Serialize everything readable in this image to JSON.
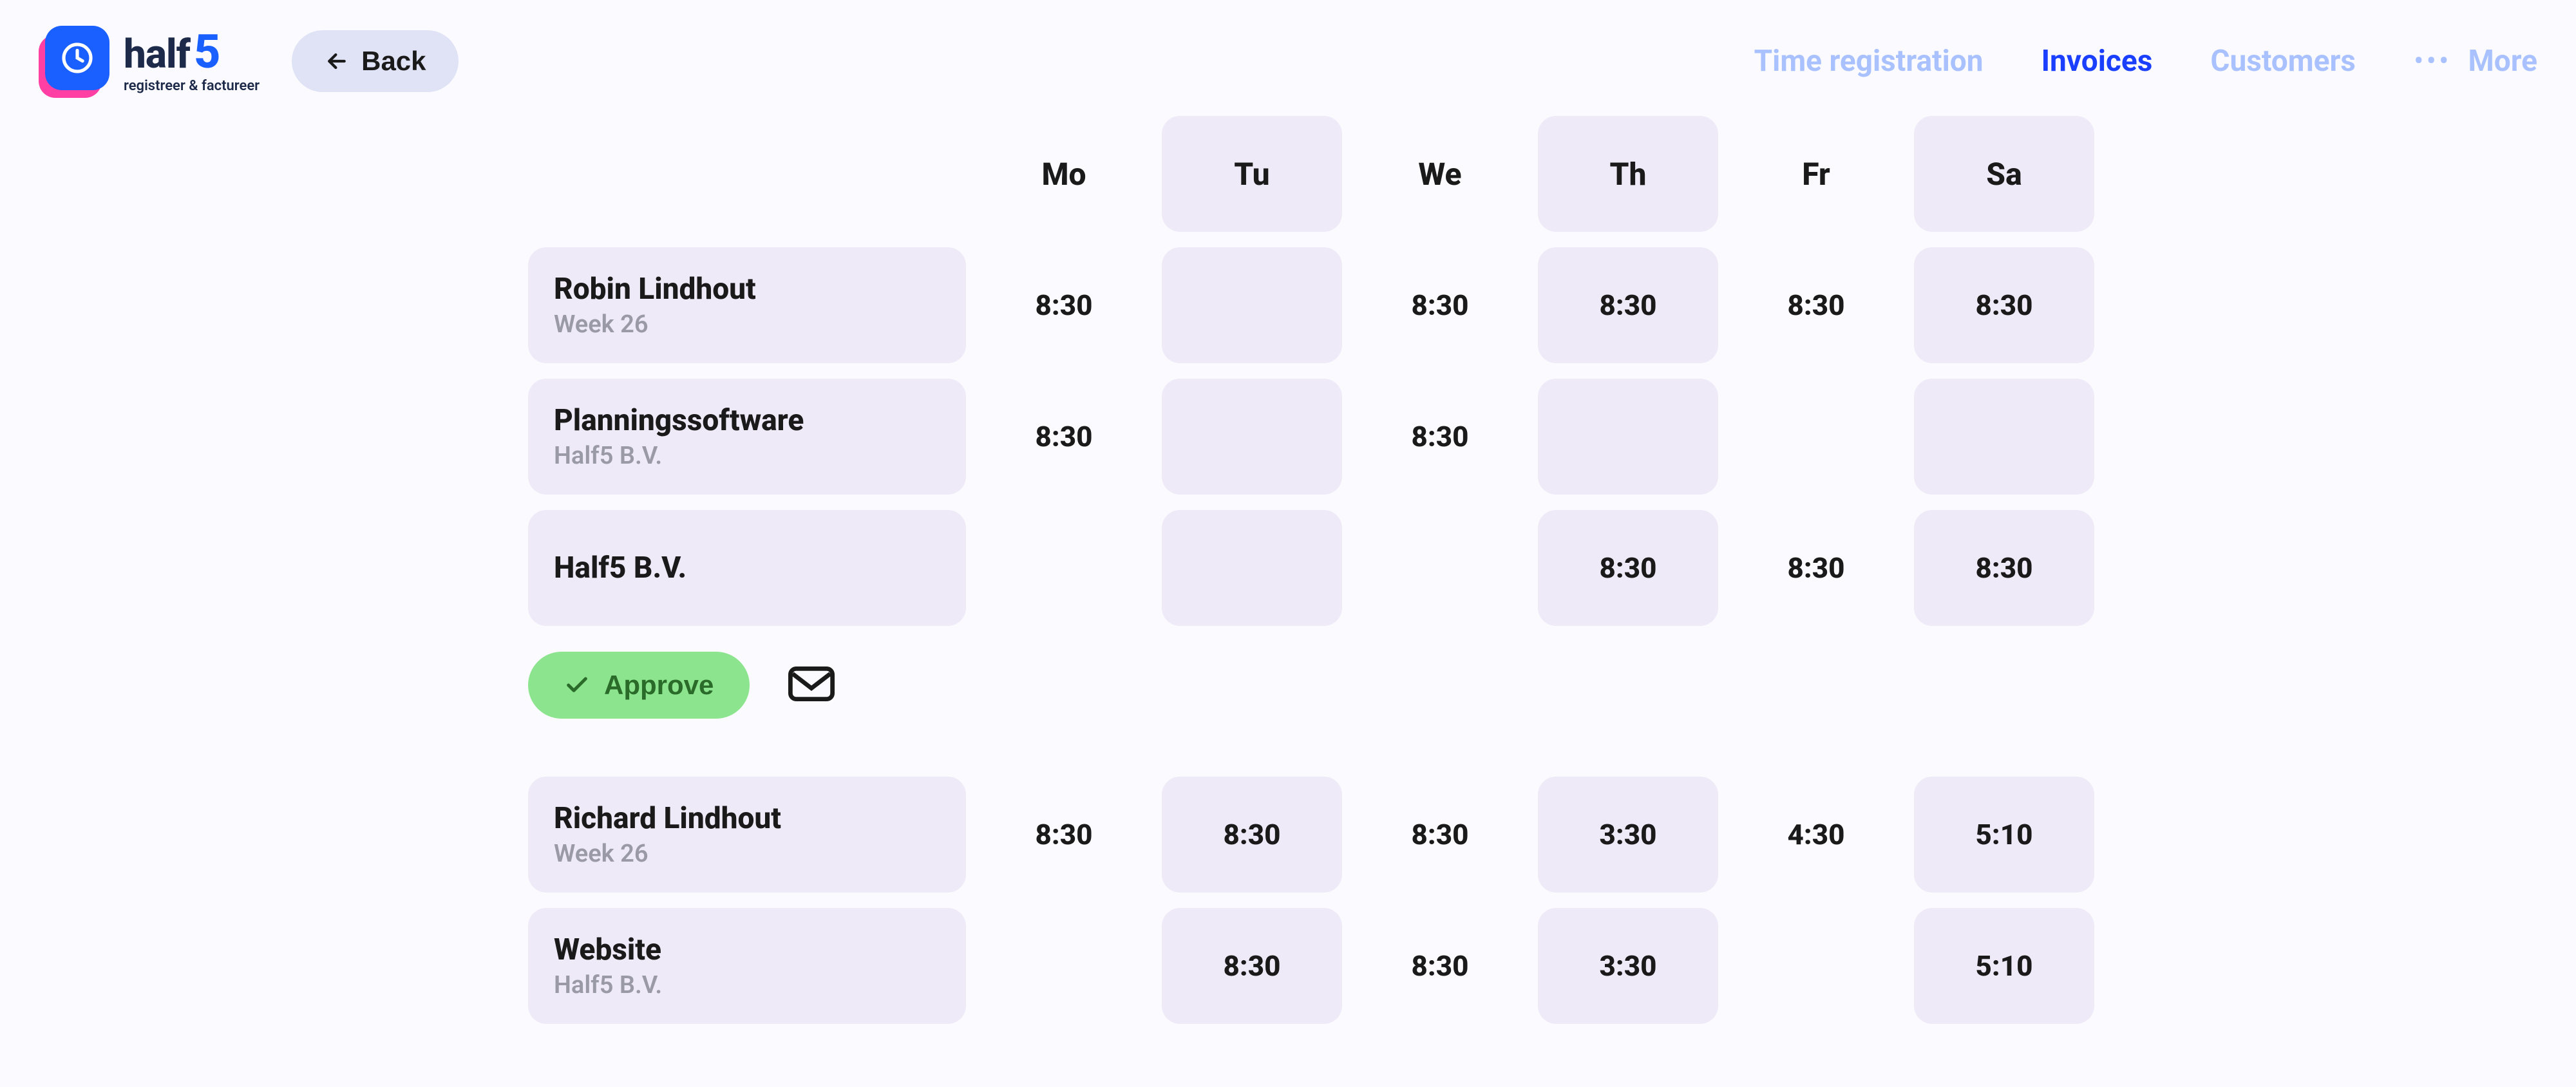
{
  "brand": {
    "name_part1": "half",
    "name_part2": "5",
    "tagline": "registreer & factureer"
  },
  "back_label": "Back",
  "nav": {
    "time_registration": "Time registration",
    "invoices": "Invoices",
    "customers": "Customers",
    "more": "More"
  },
  "days": [
    "Mo",
    "Tu",
    "We",
    "Th",
    "Fr",
    "Sa"
  ],
  "shaded_days": [
    false,
    true,
    false,
    true,
    false,
    true
  ],
  "sections": [
    {
      "person": "Robin Lindhout",
      "week": "Week 26",
      "totals": [
        "8:30",
        "",
        "8:30",
        "8:30",
        "8:30",
        "8:30"
      ],
      "rows": [
        {
          "title": "Planningssoftware",
          "sub": "Half5 B.V.",
          "vals": [
            "8:30",
            "",
            "8:30",
            "",
            "",
            ""
          ]
        },
        {
          "title": "Half5 B.V.",
          "sub": "",
          "vals": [
            "",
            "",
            "",
            "8:30",
            "8:30",
            "8:30"
          ]
        }
      ],
      "approve_label": "Approve"
    },
    {
      "person": "Richard Lindhout",
      "week": "Week 26",
      "totals": [
        "8:30",
        "8:30",
        "8:30",
        "3:30",
        "4:30",
        "5:10"
      ],
      "rows": [
        {
          "title": "Website",
          "sub": "Half5 B.V.",
          "vals": [
            "",
            "8:30",
            "8:30",
            "3:30",
            "",
            "5:10"
          ]
        }
      ]
    }
  ]
}
